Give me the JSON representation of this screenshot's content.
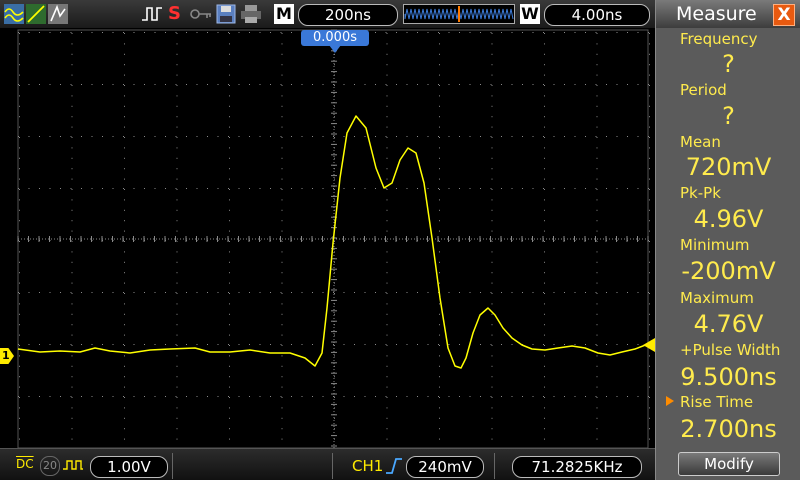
{
  "toolbar": {
    "mode_box": "M",
    "timebase": "200ns",
    "window_box": "W",
    "window_time": "4.00ns",
    "trigger_status": "S"
  },
  "scope": {
    "trigger_position": "0.000s",
    "channel_marker": "1",
    "trace_color": "#ffff00",
    "grid_color": "#8a8a8a"
  },
  "measure": {
    "title": "Measure",
    "close": "X",
    "items": [
      {
        "label": "Frequency",
        "value": "?"
      },
      {
        "label": "Period",
        "value": "?"
      },
      {
        "label": "Mean",
        "value": "720mV"
      },
      {
        "label": "Pk-Pk",
        "value": "4.96V"
      },
      {
        "label": "Minimum",
        "value": "-200mV"
      },
      {
        "label": "Maximum",
        "value": "4.76V"
      },
      {
        "label": "+Pulse Width",
        "value": "9.500ns"
      },
      {
        "label": "Rise Time",
        "value": "2.700ns"
      }
    ],
    "modify": "Modify",
    "accent": "#ffeb4d"
  },
  "status": {
    "coupling": "DC",
    "bw_limit": "20",
    "volts_div": "1.00V",
    "trigger_source": "CH1",
    "trigger_level": "240mV",
    "frequency": "71.2825KHz"
  }
}
